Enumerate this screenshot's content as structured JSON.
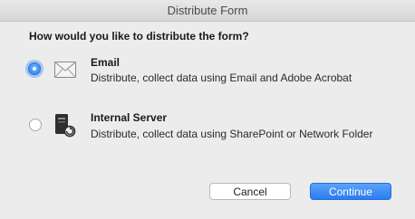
{
  "window": {
    "title": "Distribute Form"
  },
  "question": "How would you like to distribute the form?",
  "options": [
    {
      "id": "email",
      "title": "Email",
      "description": "Distribute, collect data using Email and Adobe Acrobat",
      "icon": "envelope-icon",
      "selected": true
    },
    {
      "id": "internal-server",
      "title": "Internal Server",
      "description": "Distribute, collect data using SharePoint or Network Folder",
      "icon": "server-icon",
      "selected": false
    }
  ],
  "buttons": {
    "cancel": "Cancel",
    "continue": "Continue"
  },
  "colors": {
    "accent": "#2b7cf2",
    "window_bg": "#ececec"
  }
}
